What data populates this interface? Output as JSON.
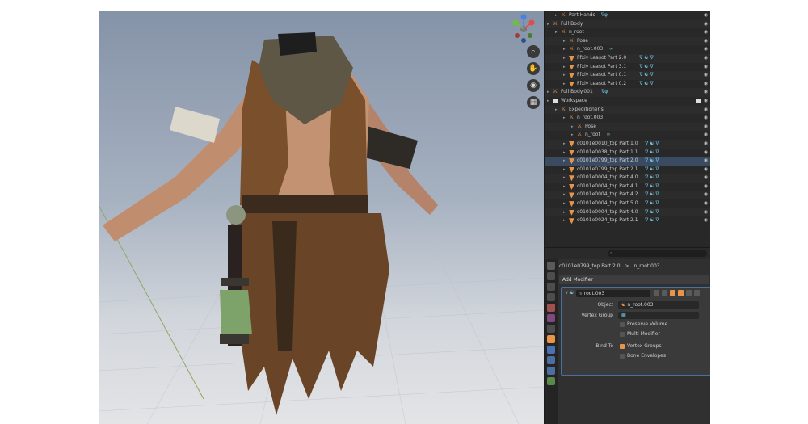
{
  "outliner": {
    "rows": [
      {
        "label": "Part Hands",
        "indent": 1,
        "icon": "armature",
        "tag": "∇φ"
      },
      {
        "label": "Full Body",
        "indent": 0,
        "icon": "armature",
        "tag": ""
      },
      {
        "label": "n_root",
        "indent": 1,
        "icon": "armature",
        "tag": ""
      },
      {
        "label": "Pose",
        "indent": 2,
        "icon": "pose",
        "tag": ""
      },
      {
        "label": "n_root.003",
        "indent": 2,
        "icon": "pose",
        "tag": "∞"
      },
      {
        "label": "Ffxiv Leasot Part 2.0",
        "indent": 2,
        "icon": "mesh",
        "tag": "∇ ☯ ∇"
      },
      {
        "label": "Ffxiv Leasot Part 3.1",
        "indent": 2,
        "icon": "mesh",
        "tag": "∇ ☯ ∇"
      },
      {
        "label": "Ffxiv Leasot Part 0.1",
        "indent": 2,
        "icon": "mesh",
        "tag": "∇ ☯ ∇"
      },
      {
        "label": "Ffxiv Leasot Part 0.2",
        "indent": 2,
        "icon": "mesh",
        "tag": "∇ ☯ ∇"
      },
      {
        "label": "Full Body.001",
        "indent": 0,
        "icon": "armature",
        "tag": "∇φ"
      },
      {
        "label": "Workspace",
        "indent": 0,
        "icon": "collection",
        "tag": ""
      },
      {
        "label": "Expeditioner's",
        "indent": 1,
        "icon": "armature",
        "tag": ""
      },
      {
        "label": "n_root.003",
        "indent": 2,
        "icon": "armature",
        "tag": ""
      },
      {
        "label": "Pose",
        "indent": 3,
        "icon": "pose",
        "tag": ""
      },
      {
        "label": "n_root",
        "indent": 3,
        "icon": "pose",
        "tag": "∞"
      },
      {
        "label": "c0101e0010_top Part 1.0",
        "indent": 2,
        "icon": "mesh",
        "tag": "∇ ☯ ∇"
      },
      {
        "label": "c0101e0038_top Part 1.1",
        "indent": 2,
        "icon": "mesh",
        "tag": "∇ ☯ ∇"
      },
      {
        "label": "c0101e0799_top Part 2.0",
        "indent": 2,
        "icon": "mesh",
        "tag": "∇ ☯ ∇",
        "selected": true
      },
      {
        "label": "c0101e0799_top Part 2.1",
        "indent": 2,
        "icon": "mesh",
        "tag": "∇ ☯ ∇"
      },
      {
        "label": "c0101e0004_top Part 4.0",
        "indent": 2,
        "icon": "mesh",
        "tag": "∇ ☯ ∇"
      },
      {
        "label": "c0101e0004_top Part 4.1",
        "indent": 2,
        "icon": "mesh",
        "tag": "∇ ☯ ∇"
      },
      {
        "label": "c0101e0004_top Part 4.2",
        "indent": 2,
        "icon": "mesh",
        "tag": "∇ ☯ ∇"
      },
      {
        "label": "c0101e0004_top Part 5.0",
        "indent": 2,
        "icon": "mesh",
        "tag": "∇ ☯ ∇"
      },
      {
        "label": "c0101e0004_top Part 4.0",
        "indent": 2,
        "icon": "mesh",
        "tag": "∇ ☯ ∇"
      },
      {
        "label": "c0101e0024_top Part 2.1",
        "indent": 2,
        "icon": "mesh",
        "tag": "∇ ☯ ∇"
      }
    ]
  },
  "properties": {
    "search_placeholder": "⌕",
    "breadcrumb_object": "c0101e0799_top Part 2.0",
    "breadcrumb_sep": ">",
    "breadcrumb_modifier": "n_root.003",
    "add_modifier": "Add Modifier",
    "modifier_name": "n_root.003",
    "object_label": "Object",
    "object_value": "n_root.003",
    "vertex_group_label": "Vertex Group",
    "vertex_group_value": "",
    "preserve_volume": "Preserve Volume",
    "multi_modifier": "Multi Modifier",
    "bind_to_label": "Bind To",
    "vertex_groups": "Vertex Groups",
    "bone_envelopes": "Bone Envelopes"
  },
  "colors": {
    "accent": "#e8954a",
    "selection": "#4a6fa0"
  }
}
